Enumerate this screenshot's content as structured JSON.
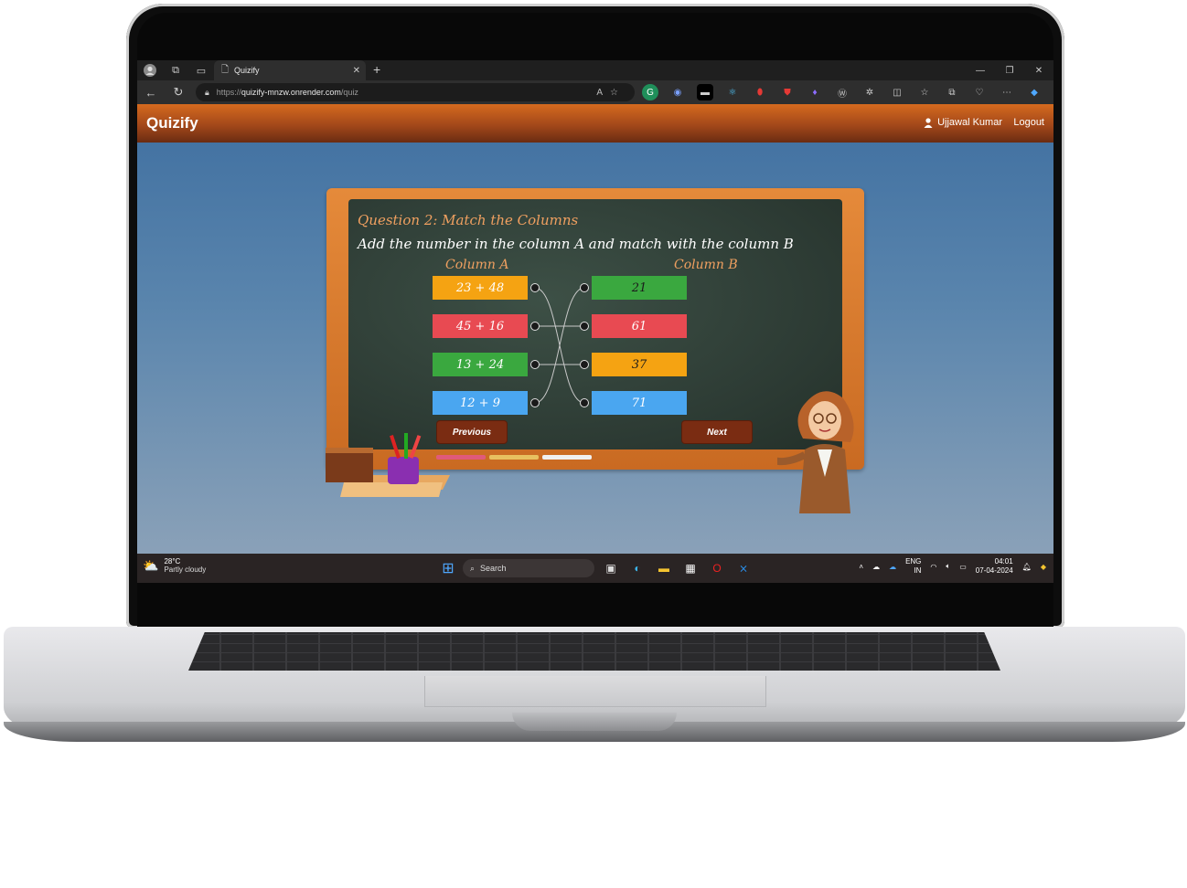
{
  "browser": {
    "tab_title": "Quizify",
    "url_scheme": "https://",
    "url_host": "quizify-mnzw.onrender.com",
    "url_path": "/quiz"
  },
  "app": {
    "brand": "Quizify",
    "user_name": "Ujjawal Kumar",
    "logout_label": "Logout"
  },
  "quiz": {
    "title": "Question 2: Match the Columns",
    "instruction": "Add the number in the column A and match with the column B",
    "column_a_label": "Column A",
    "column_b_label": "Column B",
    "column_a": [
      {
        "text": "23 + 48",
        "color": "#f5a312"
      },
      {
        "text": "45 + 16",
        "color": "#e84a52"
      },
      {
        "text": "13 + 24",
        "color": "#3aa83f"
      },
      {
        "text": "12 + 9",
        "color": "#4aa6f0"
      }
    ],
    "column_b": [
      {
        "text": "21",
        "color": "#3aa83f"
      },
      {
        "text": "61",
        "color": "#e84a52"
      },
      {
        "text": "37",
        "color": "#f5a312"
      },
      {
        "text": "71",
        "color": "#4aa6f0"
      }
    ],
    "matches": [
      [
        0,
        3
      ],
      [
        1,
        1
      ],
      [
        2,
        2
      ],
      [
        3,
        0
      ]
    ],
    "previous_label": "Previous",
    "next_label": "Next"
  },
  "taskbar": {
    "temperature": "28°C",
    "weather": "Partly cloudy",
    "search_placeholder": "Search",
    "lang_top": "ENG",
    "lang_bottom": "IN",
    "time": "04:01",
    "date": "07-04-2024"
  }
}
